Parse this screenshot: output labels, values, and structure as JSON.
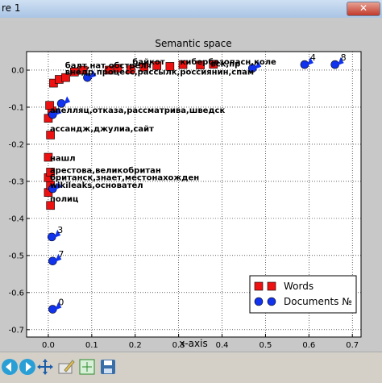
{
  "window": {
    "title": "re 1"
  },
  "toolbar": {
    "icons": [
      "back-arrow-icon",
      "forward-arrow-icon",
      "pan-icon",
      "edit-icon",
      "subplots-icon",
      "save-icon"
    ]
  },
  "chart_data": {
    "type": "scatter",
    "title": "Semantic space",
    "xlabel": "x-axis",
    "ylabel": "",
    "xlim": [
      -0.05,
      0.72
    ],
    "ylim": [
      -0.72,
      0.05
    ],
    "xticks": [
      {
        "v": 0.0,
        "t": "0.0"
      },
      {
        "v": 0.1,
        "t": "0.1"
      },
      {
        "v": 0.2,
        "t": "0.2"
      },
      {
        "v": 0.3,
        "t": "0.3"
      },
      {
        "v": 0.4,
        "t": "0.4"
      },
      {
        "v": 0.5,
        "t": "0.5"
      },
      {
        "v": 0.6,
        "t": "0.6"
      },
      {
        "v": 0.7,
        "t": "0.7"
      }
    ],
    "yticks": [
      {
        "v": 0.0,
        "t": "0.0"
      },
      {
        "v": -0.1,
        "t": "-0.1"
      },
      {
        "v": -0.2,
        "t": "-0.2"
      },
      {
        "v": -0.3,
        "t": "-0.3"
      },
      {
        "v": -0.4,
        "t": "-0.4"
      },
      {
        "v": -0.5,
        "t": "-0.5"
      },
      {
        "v": -0.6,
        "t": "-0.6"
      },
      {
        "v": -0.7,
        "t": "-0.7"
      }
    ],
    "grid": true,
    "legend": {
      "placement": "bottom-right"
    },
    "series": [
      {
        "name": "Words",
        "marker": "square",
        "color": "#ee1111",
        "points": [
          {
            "x": 0.005,
            "y": -0.365,
            "label": ""
          },
          {
            "x": 0.0,
            "y": -0.33,
            "label": ""
          },
          {
            "x": 0.005,
            "y": -0.31,
            "label": ""
          },
          {
            "x": 0.0,
            "y": -0.29,
            "label": ""
          },
          {
            "x": 0.005,
            "y": -0.275,
            "label": ""
          },
          {
            "x": 0.0,
            "y": -0.235,
            "label": ""
          },
          {
            "x": 0.005,
            "y": -0.175,
            "label": ""
          },
          {
            "x": 0.0,
            "y": -0.13,
            "label": ""
          },
          {
            "x": 0.008,
            "y": -0.11,
            "label": ""
          },
          {
            "x": 0.003,
            "y": -0.095,
            "label": ""
          },
          {
            "x": 0.012,
            "y": -0.035,
            "label": ""
          },
          {
            "x": 0.025,
            "y": -0.025,
            "label": ""
          },
          {
            "x": 0.04,
            "y": -0.02,
            "label": ""
          },
          {
            "x": 0.06,
            "y": -0.005,
            "label": ""
          },
          {
            "x": 0.08,
            "y": 0.0,
            "label": ""
          },
          {
            "x": 0.14,
            "y": 0.0,
            "label": ""
          },
          {
            "x": 0.16,
            "y": 0.005,
            "label": ""
          },
          {
            "x": 0.19,
            "y": 0.002,
            "label": ""
          },
          {
            "x": 0.22,
            "y": 0.008,
            "label": ""
          },
          {
            "x": 0.25,
            "y": 0.012,
            "label": ""
          },
          {
            "x": 0.28,
            "y": 0.01,
            "label": ""
          },
          {
            "x": 0.31,
            "y": 0.015,
            "label": ""
          },
          {
            "x": 0.35,
            "y": 0.014,
            "label": ""
          },
          {
            "x": 0.38,
            "y": 0.016,
            "label": ""
          }
        ]
      },
      {
        "name": "Documents №",
        "marker": "circle",
        "color": "#1133ee",
        "points": [
          {
            "x": 0.01,
            "y": -0.645,
            "label": "0"
          },
          {
            "x": 0.01,
            "y": -0.515,
            "label": "7"
          },
          {
            "x": 0.008,
            "y": -0.45,
            "label": "3"
          },
          {
            "x": 0.01,
            "y": -0.32,
            "label": ""
          },
          {
            "x": 0.01,
            "y": -0.12,
            "label": ""
          },
          {
            "x": 0.03,
            "y": -0.09,
            "label": ""
          },
          {
            "x": 0.09,
            "y": -0.02,
            "label": ""
          },
          {
            "x": 0.47,
            "y": 0.005,
            "label": ""
          },
          {
            "x": 0.59,
            "y": 0.015,
            "label": "4"
          },
          {
            "x": 0.66,
            "y": 0.015,
            "label": "8"
          }
        ]
      }
    ],
    "annotations": [
      {
        "x": 0.035,
        "y": 0.005,
        "text": "балт,нат,обстреля"
      },
      {
        "x": 0.035,
        "y": -0.012,
        "text": "внедр,процесс,рассылк,россиянин,спам"
      },
      {
        "x": 0.19,
        "y": 0.015,
        "text": "байкот"
      },
      {
        "x": 0.3,
        "y": 0.015,
        "text": "кибербезопасн,коле"
      },
      {
        "x": 0.37,
        "y": 0.01,
        "text": "вск,пр"
      },
      {
        "x": 0.0,
        "y": -0.115,
        "text": "апелляц,отказа,рассматрива,шведск"
      },
      {
        "x": 0.0,
        "y": -0.165,
        "text": "ассандж,джулиа,сайт"
      },
      {
        "x": 0.0,
        "y": -0.245,
        "text": "нашл"
      },
      {
        "x": 0.0,
        "y": -0.277,
        "text": "арестова,великобритан"
      },
      {
        "x": 0.0,
        "y": -0.297,
        "text": "британск,знает,местонахожден"
      },
      {
        "x": 0.0,
        "y": -0.318,
        "text": "wikileaks,основател"
      },
      {
        "x": 0.0,
        "y": -0.355,
        "text": "полиц"
      }
    ]
  }
}
